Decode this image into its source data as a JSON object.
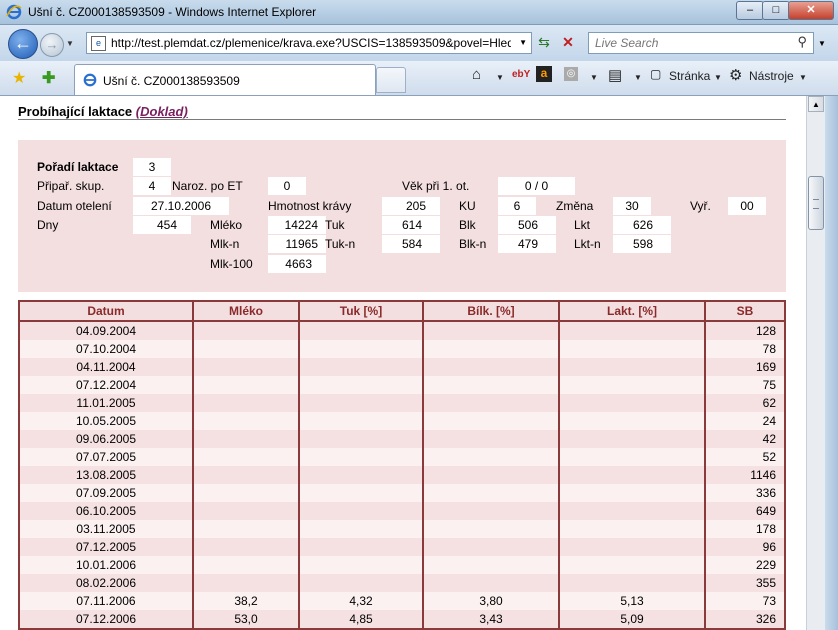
{
  "window": {
    "title": "Ušní č. CZ000138593509 - Windows Internet Explorer",
    "min": "–",
    "max": "□",
    "close": "✕"
  },
  "address": {
    "url": "http://test.plemdat.cz/plemenice/krava.exe?USCIS=138593509&povel=Hled",
    "search_placeholder": "Live Search"
  },
  "tab": {
    "label": "Ušní č. CZ000138593509"
  },
  "toolbar": {
    "ebay": "ebY",
    "amazon": "a",
    "page_label": "Stránka",
    "tools_label": "Nástroje"
  },
  "section": {
    "title": "Probíhající laktace",
    "link": "(Doklad)"
  },
  "info": {
    "poradi_label": "Pořadí laktace",
    "poradi": "3",
    "pripar_label": "Připař. skup.",
    "pripar": "4",
    "naroz_label": "Naroz. po ET",
    "naroz": "0",
    "vek_label": "Věk při 1. ot.",
    "vek": "0 / 0",
    "datum_label": "Datum otelení",
    "datum": "27.10.2006",
    "hmotnost_label": "Hmotnost krávy",
    "hmotnost": "205",
    "ku_label": "KU",
    "ku": "6",
    "zmena_label": "Změna",
    "zmena": "30",
    "vyr_label": "Vyř.",
    "vyr": "00",
    "dny_label": "Dny",
    "dny": "454",
    "mleko_label": "Mléko",
    "mleko": "14224",
    "tuk_label": "Tuk",
    "tuk": "614",
    "blk_label": "Blk",
    "blk": "506",
    "lkt_label": "Lkt",
    "lkt": "626",
    "mlkn_label": "Mlk-n",
    "mlkn": "11965",
    "tukn_label": "Tuk-n",
    "tukn": "584",
    "blkn_label": "Blk-n",
    "blkn": "479",
    "lktn_label": "Lkt-n",
    "lktn": "598",
    "mlk100_label": "Mlk-100",
    "mlk100": "4663"
  },
  "table": {
    "headers": [
      "Datum",
      "Mléko",
      "Tuk [%]",
      "Bílk. [%]",
      "Lakt. [%]",
      "SB"
    ],
    "rows": [
      [
        "04.09.2004",
        "",
        "",
        "",
        "",
        "128"
      ],
      [
        "07.10.2004",
        "",
        "",
        "",
        "",
        "78"
      ],
      [
        "04.11.2004",
        "",
        "",
        "",
        "",
        "169"
      ],
      [
        "07.12.2004",
        "",
        "",
        "",
        "",
        "75"
      ],
      [
        "11.01.2005",
        "",
        "",
        "",
        "",
        "62"
      ],
      [
        "10.05.2005",
        "",
        "",
        "",
        "",
        "24"
      ],
      [
        "09.06.2005",
        "",
        "",
        "",
        "",
        "42"
      ],
      [
        "07.07.2005",
        "",
        "",
        "",
        "",
        "52"
      ],
      [
        "13.08.2005",
        "",
        "",
        "",
        "",
        "1146"
      ],
      [
        "07.09.2005",
        "",
        "",
        "",
        "",
        "336"
      ],
      [
        "06.10.2005",
        "",
        "",
        "",
        "",
        "649"
      ],
      [
        "03.11.2005",
        "",
        "",
        "",
        "",
        "178"
      ],
      [
        "07.12.2005",
        "",
        "",
        "",
        "",
        "96"
      ],
      [
        "10.01.2006",
        "",
        "",
        "",
        "",
        "229"
      ],
      [
        "08.02.2006",
        "",
        "",
        "",
        "",
        "355"
      ],
      [
        "07.11.2006",
        "38,2",
        "4,32",
        "3,80",
        "5,13",
        "73"
      ],
      [
        "07.12.2006",
        "53,0",
        "4,85",
        "3,43",
        "5,09",
        "326"
      ]
    ]
  }
}
